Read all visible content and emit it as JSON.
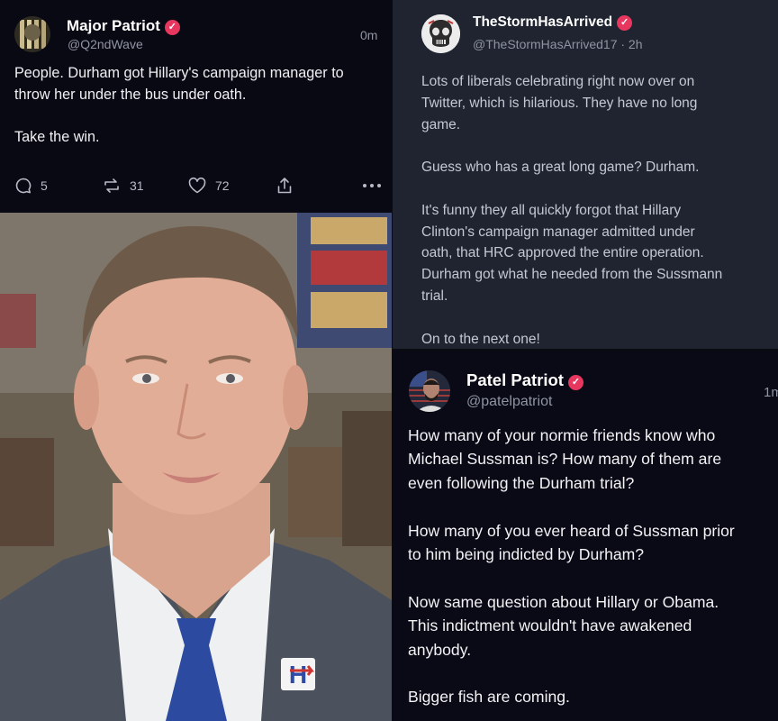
{
  "left_post": {
    "author_name": "Major Patriot",
    "handle": "@Q2ndWave",
    "time": "0m",
    "body": "People. Durham got Hillary's campaign manager to\nthrow her under the bus under oath.\n\nTake the win.",
    "replies": "5",
    "reposts": "31",
    "likes": "72"
  },
  "right_top_post": {
    "author_name": "TheStormHasArrived",
    "handle_time": "@TheStormHasArrived17 · 2h",
    "body": "Lots of liberals celebrating right now over on\nTwitter, which is hilarious. They have no long\ngame.\n\nGuess who has a great long game? Durham.\n\nIt's funny they all quickly forgot that Hillary\nClinton's campaign manager admitted under\noath, that HRC approved the entire operation.\nDurham got what he needed from the Sussmann\ntrial.\n\nOn to the next one!"
  },
  "right_bottom_post": {
    "author_name": "Patel Patriot",
    "handle": "@patelpatriot",
    "time": "1m",
    "body": "How many of your normie friends know who\nMichael Sussman is? How many of them are\neven following the Durham trial?\n\nHow many of you ever heard of Sussman prior\nto him being indicted by Durham?\n\nNow same question about Hillary or Obama.\nThis indictment wouldn't have awakened\nanybody.\n\nBigger fish are coming."
  },
  "icons": {
    "verified": "verified-badge-icon",
    "reply": "reply-bubble-icon",
    "repost": "repost-arrows-icon",
    "like": "heart-icon",
    "share": "share-upload-icon",
    "more": "ellipsis-icon"
  },
  "colors": {
    "verified_badge": "#e8375f",
    "left_background": "#090913",
    "right_top_background": "#1f2430",
    "right_bottom_background": "#0a0a16"
  }
}
